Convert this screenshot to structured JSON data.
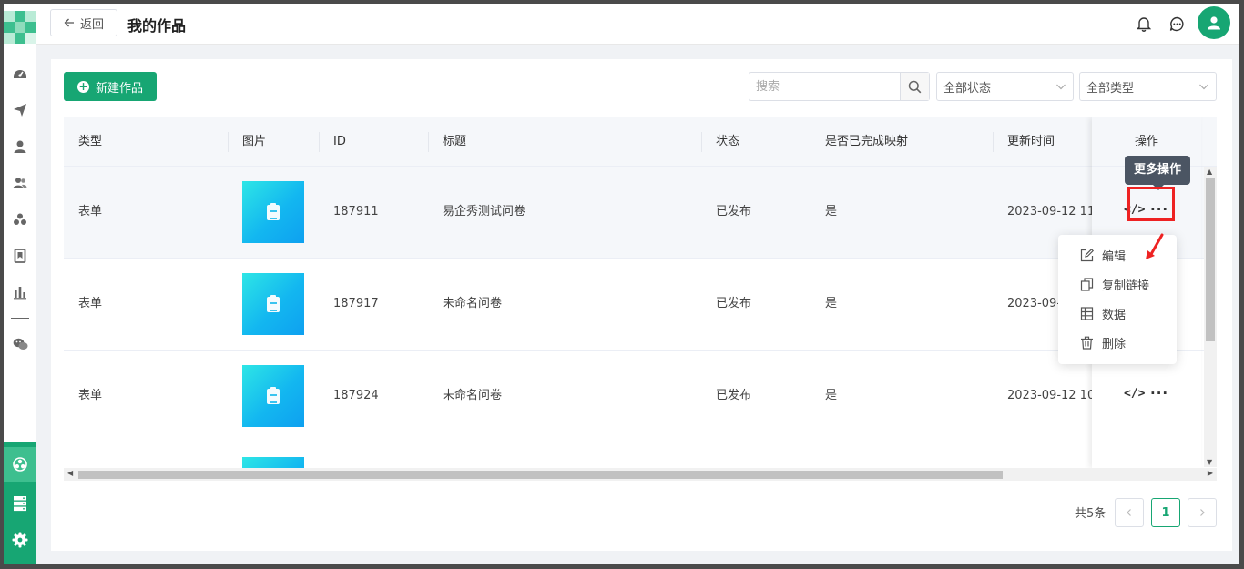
{
  "header": {
    "back_label": "返回",
    "title": "我的作品"
  },
  "toolbar": {
    "new_label": "新建作品",
    "search_placeholder": "搜索",
    "status_filter": "全部状态",
    "type_filter": "全部类型"
  },
  "table": {
    "columns": [
      "类型",
      "图片",
      "ID",
      "标题",
      "状态",
      "是否已完成映射",
      "更新时间",
      "操作"
    ],
    "rows": [
      {
        "type": "表单",
        "id": "187911",
        "title": "易企秀测试问卷",
        "status": "已发布",
        "mapped": "是",
        "updated": "2023-09-12 11:"
      },
      {
        "type": "表单",
        "id": "187917",
        "title": "未命名问卷",
        "status": "已发布",
        "mapped": "是",
        "updated": "2023-09-"
      },
      {
        "type": "表单",
        "id": "187924",
        "title": "未命名问卷",
        "status": "已发布",
        "mapped": "是",
        "updated": "2023-09-12 10:"
      }
    ],
    "code_glyph": "</>",
    "more_glyph": "···"
  },
  "tooltip": "更多操作",
  "menu": {
    "items": [
      {
        "label": "编辑",
        "icon": "edit-icon"
      },
      {
        "label": "复制链接",
        "icon": "copy-link-icon"
      },
      {
        "label": "数据",
        "icon": "data-icon"
      },
      {
        "label": "删除",
        "icon": "delete-icon"
      }
    ]
  },
  "pagination": {
    "total": "共5条",
    "current": "1"
  },
  "colors": {
    "brand": "#17a673",
    "highlight": "#ee2222"
  }
}
